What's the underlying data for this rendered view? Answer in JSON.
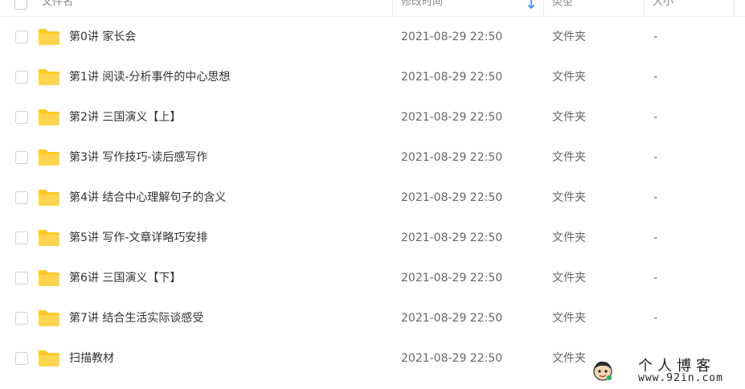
{
  "header": {
    "name_label": "文件名",
    "time_label": "修改时间",
    "type_label": "类型",
    "size_label": "大小",
    "sort_icon": "arrow-down-icon"
  },
  "rows": [
    {
      "name": "第0讲 家长会",
      "time": "2021-08-29 22:50",
      "type": "文件夹",
      "size": "-"
    },
    {
      "name": "第1讲 阅读-分析事件的中心思想",
      "time": "2021-08-29 22:50",
      "type": "文件夹",
      "size": "-"
    },
    {
      "name": "第2讲 三国演义【上】",
      "time": "2021-08-29 22:50",
      "type": "文件夹",
      "size": "-"
    },
    {
      "name": "第3讲 写作技巧-读后感写作",
      "time": "2021-08-29 22:50",
      "type": "文件夹",
      "size": "-"
    },
    {
      "name": "第4讲 结合中心理解句子的含义",
      "time": "2021-08-29 22:50",
      "type": "文件夹",
      "size": "-"
    },
    {
      "name": "第5讲 写作-文章详略巧安排",
      "time": "2021-08-29 22:50",
      "type": "文件夹",
      "size": "-"
    },
    {
      "name": "第6讲 三国演义【下】",
      "time": "2021-08-29 22:50",
      "type": "文件夹",
      "size": "-"
    },
    {
      "name": "第7讲 结合生活实际谈感受",
      "time": "2021-08-29 22:50",
      "type": "文件夹",
      "size": "-"
    },
    {
      "name": "扫描教材",
      "time": "2021-08-29 22:50",
      "type": "文件夹",
      "size": ""
    }
  ],
  "watermark": {
    "title": "个人博客",
    "url": "www.92in.com"
  },
  "colors": {
    "folder": "#ffca28",
    "sort_accent": "#2b8df5"
  }
}
